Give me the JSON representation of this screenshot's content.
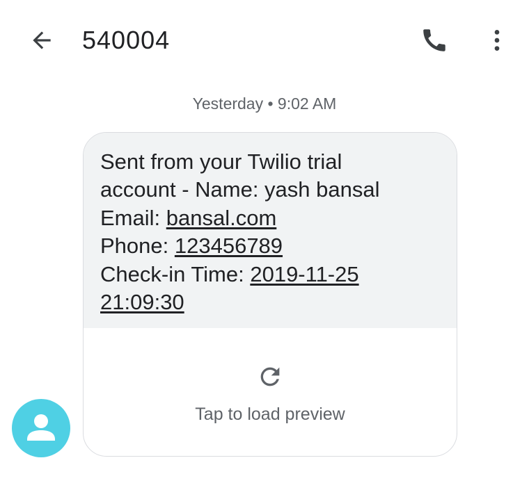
{
  "header": {
    "title": "540004",
    "back_icon": "arrow-back-icon",
    "call_icon": "phone-icon",
    "menu_icon": "more-vert-icon"
  },
  "conversation": {
    "timestamp": "Yesterday • 9:02 AM",
    "message": {
      "line1": "Sent from your Twilio trial",
      "line2": "account - Name: yash bansal",
      "email_label": "Email: ",
      "email_link": "bansal.com",
      "phone_label": "Phone: ",
      "phone_link": "123456789",
      "checkin_label": "Check-in Time: ",
      "checkin_date_link": "2019-11-25",
      "checkin_time_link": "21:09:30"
    },
    "preview": {
      "label": "Tap to load preview",
      "icon": "refresh-icon"
    },
    "avatar_icon": "person-icon",
    "avatar_color": "#4fd0e4"
  },
  "colors": {
    "bubble_bg": "#f1f3f4",
    "text_primary": "#202124",
    "text_secondary": "#5f6368"
  }
}
